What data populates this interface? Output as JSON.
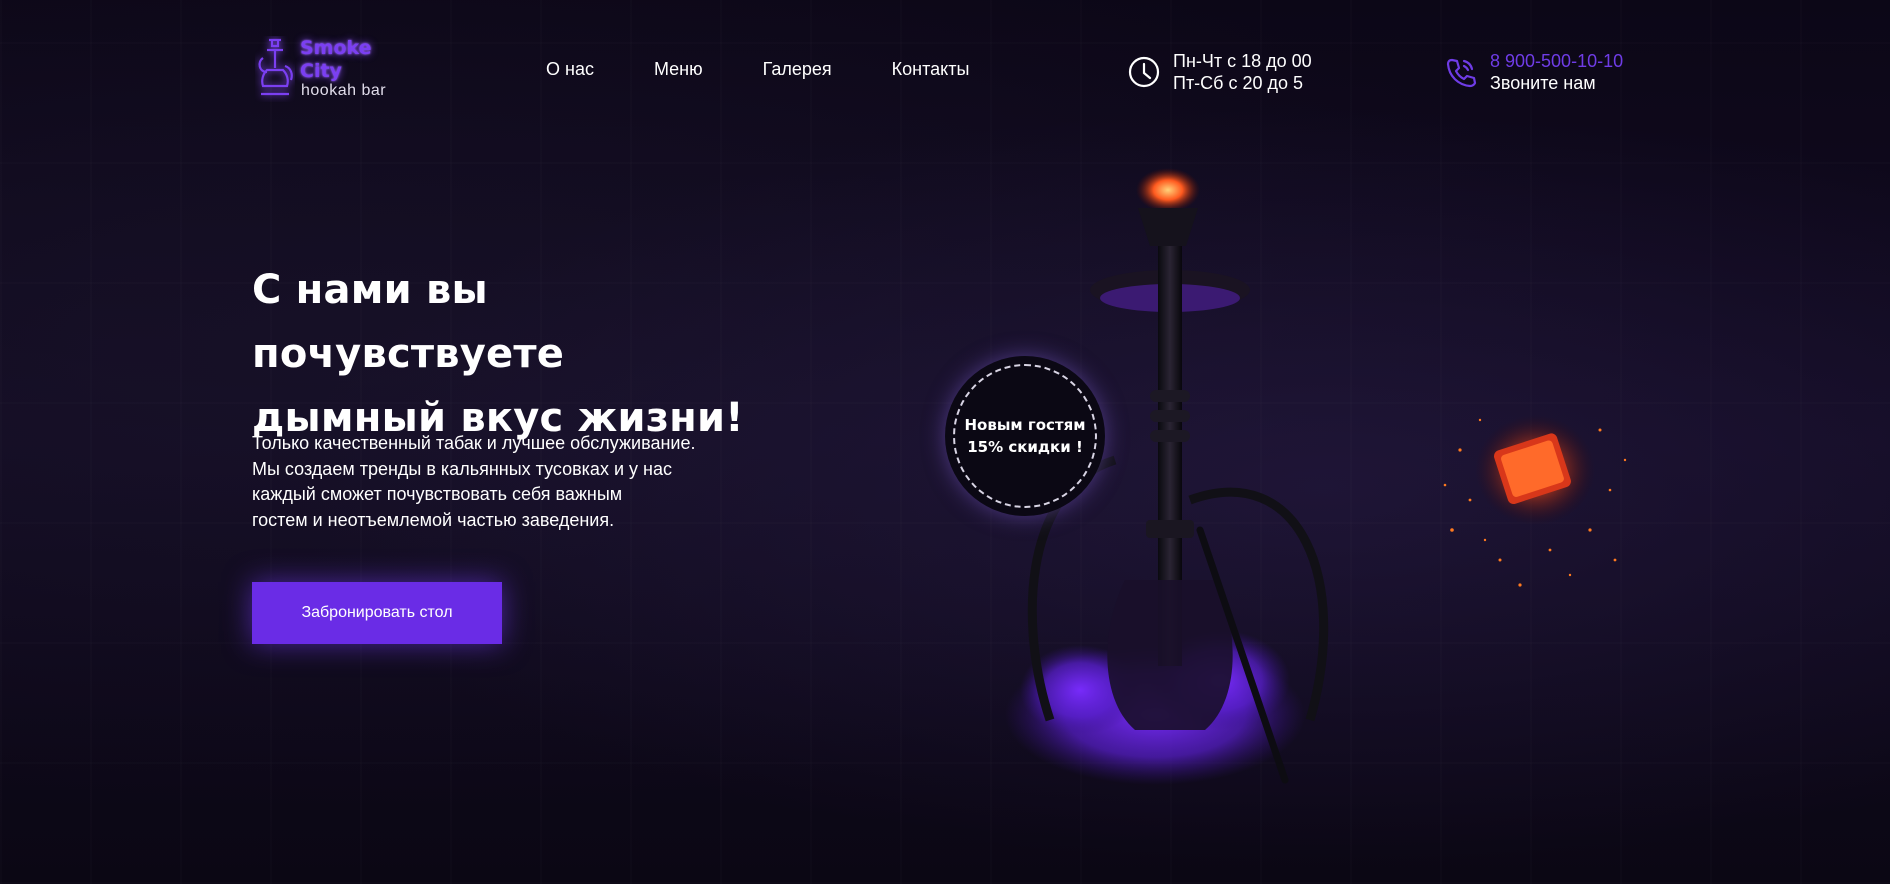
{
  "header": {
    "logo": {
      "line1": "Smoke",
      "line2": "City",
      "subtitle": "hookah bar"
    },
    "nav": [
      {
        "label": "О нас"
      },
      {
        "label": "Меню"
      },
      {
        "label": "Галерея"
      },
      {
        "label": "Контакты"
      }
    ],
    "hours": {
      "line1": "Пн-Чт с 18 до 00",
      "line2": "Пт-Сб с 20 до 5",
      "icon": "clock-icon"
    },
    "phone": {
      "number": "8 900-500-10-10",
      "caption": "Звоните нам",
      "icon": "phone-icon"
    }
  },
  "hero": {
    "title_line1": "С нами вы почувствуете",
    "title_line2": "дымный вкус жизни!",
    "description": [
      "Только качественный табак и лучшее обслуживание.",
      "Мы создаем тренды в кальянных тусовках и у нас",
      "каждый сможет почувствовать себя важным",
      "гостем и неотъемлемой частью заведения."
    ],
    "button_label": "Забронировать стол"
  },
  "promo": {
    "line1": "Новым гостям",
    "line2": "15% скидки !"
  },
  "colors": {
    "accent": "#6a2ce6",
    "phone_text": "#6f3ce6",
    "logo_glow": "#7b3ff2",
    "background": "#0d0818"
  }
}
